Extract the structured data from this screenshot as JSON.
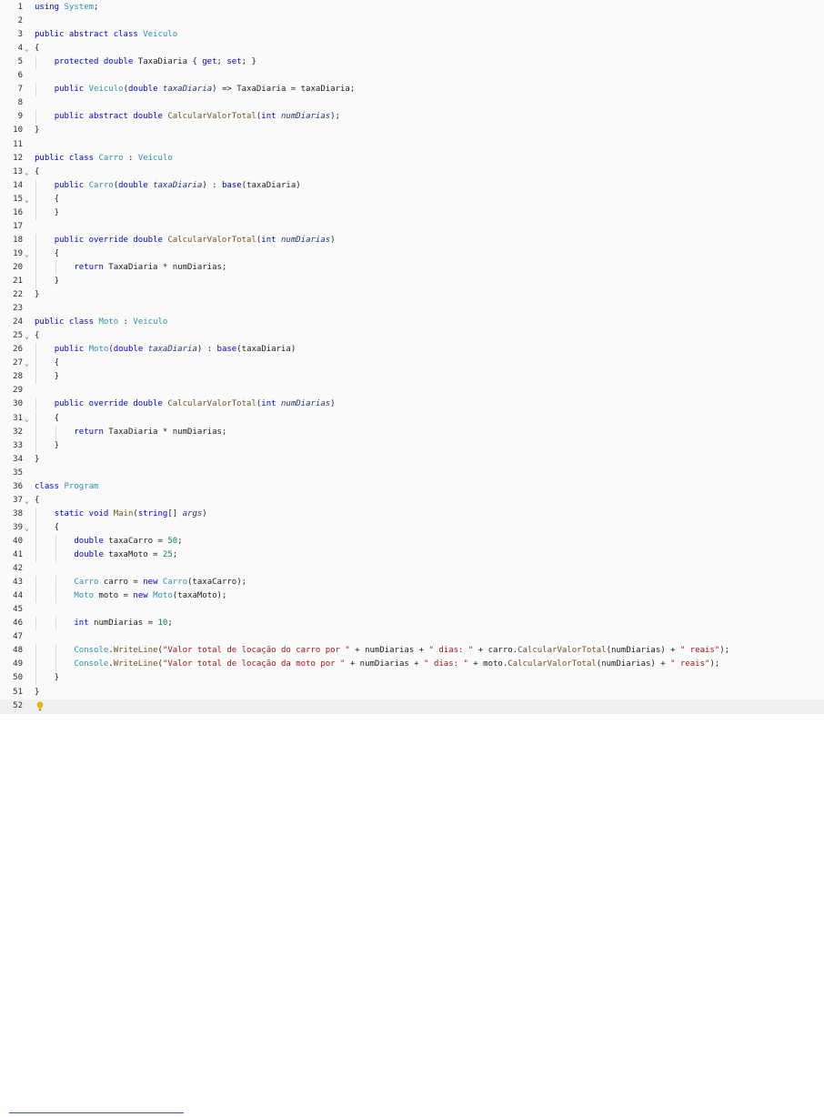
{
  "editor": {
    "language": "C#",
    "current_line": 52,
    "lines": [
      {
        "n": "1",
        "tokens": [
          [
            "kw",
            "using"
          ],
          [
            "pl",
            " "
          ],
          [
            "typ",
            "System"
          ],
          [
            "pl",
            ";"
          ]
        ]
      },
      {
        "n": "2",
        "tokens": []
      },
      {
        "n": "3",
        "tokens": [
          [
            "kw",
            "public abstract class"
          ],
          [
            "pl",
            " "
          ],
          [
            "typ",
            "Veiculo"
          ]
        ]
      },
      {
        "n": "4",
        "fold": true,
        "tokens": [
          [
            "pl",
            "{"
          ]
        ]
      },
      {
        "n": "5",
        "guides": 1,
        "tokens": [
          [
            "pl",
            "    "
          ],
          [
            "kw",
            "protected double"
          ],
          [
            "pl",
            " TaxaDiaria { "
          ],
          [
            "kw",
            "get"
          ],
          [
            "pl",
            "; "
          ],
          [
            "kw",
            "set"
          ],
          [
            "pl",
            "; }"
          ]
        ]
      },
      {
        "n": "6",
        "tokens": []
      },
      {
        "n": "7",
        "guides": 1,
        "tokens": [
          [
            "pl",
            "    "
          ],
          [
            "kw",
            "public"
          ],
          [
            "pl",
            " "
          ],
          [
            "typ",
            "Veiculo"
          ],
          [
            "pl",
            "("
          ],
          [
            "kw",
            "double"
          ],
          [
            "pl",
            " "
          ],
          [
            "prm",
            "taxaDiaria"
          ],
          [
            "pl",
            ") => TaxaDiaria = taxaDiaria;"
          ]
        ]
      },
      {
        "n": "8",
        "tokens": []
      },
      {
        "n": "9",
        "guides": 1,
        "tokens": [
          [
            "pl",
            "    "
          ],
          [
            "kw",
            "public abstract double"
          ],
          [
            "pl",
            " "
          ],
          [
            "fn",
            "CalcularValorTotal"
          ],
          [
            "pl",
            "("
          ],
          [
            "kw",
            "int"
          ],
          [
            "pl",
            " "
          ],
          [
            "prm",
            "numDiarias"
          ],
          [
            "pl",
            ");"
          ]
        ]
      },
      {
        "n": "10",
        "tokens": [
          [
            "pl",
            "}"
          ]
        ]
      },
      {
        "n": "11",
        "tokens": []
      },
      {
        "n": "12",
        "tokens": [
          [
            "kw",
            "public class"
          ],
          [
            "pl",
            " "
          ],
          [
            "typ",
            "Carro"
          ],
          [
            "pl",
            " : "
          ],
          [
            "typ",
            "Veiculo"
          ]
        ]
      },
      {
        "n": "13",
        "fold": true,
        "tokens": [
          [
            "pl",
            "{"
          ]
        ]
      },
      {
        "n": "14",
        "guides": 1,
        "tokens": [
          [
            "pl",
            "    "
          ],
          [
            "kw",
            "public"
          ],
          [
            "pl",
            " "
          ],
          [
            "typ",
            "Carro"
          ],
          [
            "pl",
            "("
          ],
          [
            "kw",
            "double"
          ],
          [
            "pl",
            " "
          ],
          [
            "prm",
            "taxaDiaria"
          ],
          [
            "pl",
            ") : "
          ],
          [
            "kw",
            "base"
          ],
          [
            "pl",
            "(taxaDiaria)"
          ]
        ]
      },
      {
        "n": "15",
        "fold": true,
        "guides": 1,
        "tokens": [
          [
            "pl",
            "    {"
          ]
        ]
      },
      {
        "n": "16",
        "guides": 1,
        "tokens": [
          [
            "pl",
            "    }"
          ]
        ]
      },
      {
        "n": "17",
        "tokens": []
      },
      {
        "n": "18",
        "guides": 1,
        "tokens": [
          [
            "pl",
            "    "
          ],
          [
            "kw",
            "public override double"
          ],
          [
            "pl",
            " "
          ],
          [
            "fn",
            "CalcularValorTotal"
          ],
          [
            "pl",
            "("
          ],
          [
            "kw",
            "int"
          ],
          [
            "pl",
            " "
          ],
          [
            "prm",
            "numDiarias"
          ],
          [
            "pl",
            ")"
          ]
        ]
      },
      {
        "n": "19",
        "fold": true,
        "guides": 1,
        "tokens": [
          [
            "pl",
            "    {"
          ]
        ]
      },
      {
        "n": "20",
        "guides": 2,
        "tokens": [
          [
            "pl",
            "        "
          ],
          [
            "kw",
            "return"
          ],
          [
            "pl",
            " TaxaDiaria * numDiarias;"
          ]
        ]
      },
      {
        "n": "21",
        "guides": 1,
        "tokens": [
          [
            "pl",
            "    }"
          ]
        ]
      },
      {
        "n": "22",
        "tokens": [
          [
            "pl",
            "}"
          ]
        ]
      },
      {
        "n": "23",
        "tokens": []
      },
      {
        "n": "24",
        "tokens": [
          [
            "kw",
            "public class"
          ],
          [
            "pl",
            " "
          ],
          [
            "typ",
            "Moto"
          ],
          [
            "pl",
            " : "
          ],
          [
            "typ",
            "Veiculo"
          ]
        ]
      },
      {
        "n": "25",
        "fold": true,
        "tokens": [
          [
            "pl",
            "{"
          ]
        ]
      },
      {
        "n": "26",
        "guides": 1,
        "tokens": [
          [
            "pl",
            "    "
          ],
          [
            "kw",
            "public"
          ],
          [
            "pl",
            " "
          ],
          [
            "typ",
            "Moto"
          ],
          [
            "pl",
            "("
          ],
          [
            "kw",
            "double"
          ],
          [
            "pl",
            " "
          ],
          [
            "prm",
            "taxaDiaria"
          ],
          [
            "pl",
            ") : "
          ],
          [
            "kw",
            "base"
          ],
          [
            "pl",
            "(taxaDiaria)"
          ]
        ]
      },
      {
        "n": "27",
        "fold": true,
        "guides": 1,
        "tokens": [
          [
            "pl",
            "    {"
          ]
        ]
      },
      {
        "n": "28",
        "guides": 1,
        "tokens": [
          [
            "pl",
            "    }"
          ]
        ]
      },
      {
        "n": "29",
        "tokens": []
      },
      {
        "n": "30",
        "guides": 1,
        "tokens": [
          [
            "pl",
            "    "
          ],
          [
            "kw",
            "public override double"
          ],
          [
            "pl",
            " "
          ],
          [
            "fn",
            "CalcularValorTotal"
          ],
          [
            "pl",
            "("
          ],
          [
            "kw",
            "int"
          ],
          [
            "pl",
            " "
          ],
          [
            "prm",
            "numDiarias"
          ],
          [
            "pl",
            ")"
          ]
        ]
      },
      {
        "n": "31",
        "fold": true,
        "guides": 1,
        "tokens": [
          [
            "pl",
            "    {"
          ]
        ]
      },
      {
        "n": "32",
        "guides": 2,
        "tokens": [
          [
            "pl",
            "        "
          ],
          [
            "kw",
            "return"
          ],
          [
            "pl",
            " TaxaDiaria * numDiarias;"
          ]
        ]
      },
      {
        "n": "33",
        "guides": 1,
        "tokens": [
          [
            "pl",
            "    }"
          ]
        ]
      },
      {
        "n": "34",
        "tokens": [
          [
            "pl",
            "}"
          ]
        ]
      },
      {
        "n": "35",
        "tokens": []
      },
      {
        "n": "36",
        "tokens": [
          [
            "kw",
            "class"
          ],
          [
            "pl",
            " "
          ],
          [
            "typ",
            "Program"
          ]
        ]
      },
      {
        "n": "37",
        "fold": true,
        "tokens": [
          [
            "pl",
            "{"
          ]
        ]
      },
      {
        "n": "38",
        "guides": 1,
        "tokens": [
          [
            "pl",
            "    "
          ],
          [
            "kw",
            "static void"
          ],
          [
            "pl",
            " "
          ],
          [
            "fn",
            "Main"
          ],
          [
            "pl",
            "("
          ],
          [
            "kw",
            "string"
          ],
          [
            "pl",
            "[] "
          ],
          [
            "prm",
            "args"
          ],
          [
            "pl",
            ")"
          ]
        ]
      },
      {
        "n": "39",
        "fold": true,
        "guides": 1,
        "tokens": [
          [
            "pl",
            "    {"
          ]
        ]
      },
      {
        "n": "40",
        "guides": 2,
        "tokens": [
          [
            "pl",
            "        "
          ],
          [
            "kw",
            "double"
          ],
          [
            "pl",
            " taxaCarro = "
          ],
          [
            "num",
            "50"
          ],
          [
            "pl",
            ";"
          ]
        ]
      },
      {
        "n": "41",
        "guides": 2,
        "tokens": [
          [
            "pl",
            "        "
          ],
          [
            "kw",
            "double"
          ],
          [
            "pl",
            " taxaMoto = "
          ],
          [
            "num",
            "25"
          ],
          [
            "pl",
            ";"
          ]
        ]
      },
      {
        "n": "42",
        "tokens": []
      },
      {
        "n": "43",
        "guides": 2,
        "tokens": [
          [
            "pl",
            "        "
          ],
          [
            "typ",
            "Carro"
          ],
          [
            "pl",
            " carro = "
          ],
          [
            "kw",
            "new"
          ],
          [
            "pl",
            " "
          ],
          [
            "typ",
            "Carro"
          ],
          [
            "pl",
            "(taxaCarro);"
          ]
        ]
      },
      {
        "n": "44",
        "guides": 2,
        "tokens": [
          [
            "pl",
            "        "
          ],
          [
            "typ",
            "Moto"
          ],
          [
            "pl",
            " moto = "
          ],
          [
            "kw",
            "new"
          ],
          [
            "pl",
            " "
          ],
          [
            "typ",
            "Moto"
          ],
          [
            "pl",
            "(taxaMoto);"
          ]
        ]
      },
      {
        "n": "45",
        "tokens": []
      },
      {
        "n": "46",
        "guides": 2,
        "tokens": [
          [
            "pl",
            "        "
          ],
          [
            "kw",
            "int"
          ],
          [
            "pl",
            " numDiarias = "
          ],
          [
            "num",
            "10"
          ],
          [
            "pl",
            ";"
          ]
        ]
      },
      {
        "n": "47",
        "tokens": []
      },
      {
        "n": "48",
        "guides": 2,
        "tokens": [
          [
            "pl",
            "        "
          ],
          [
            "typ",
            "Console"
          ],
          [
            "pl",
            "."
          ],
          [
            "fn",
            "WriteLine"
          ],
          [
            "pl",
            "("
          ],
          [
            "str",
            "\"Valor total de locação do carro por \""
          ],
          [
            "pl",
            " + numDiarias + "
          ],
          [
            "str",
            "\" dias: \""
          ],
          [
            "pl",
            " + carro."
          ],
          [
            "fn",
            "CalcularValorTotal"
          ],
          [
            "pl",
            "(numDiarias) + "
          ],
          [
            "str",
            "\" reais\""
          ],
          [
            "pl",
            ");"
          ]
        ]
      },
      {
        "n": "49",
        "guides": 2,
        "tokens": [
          [
            "pl",
            "        "
          ],
          [
            "typ",
            "Console"
          ],
          [
            "pl",
            "."
          ],
          [
            "fn",
            "WriteLine"
          ],
          [
            "pl",
            "("
          ],
          [
            "str",
            "\"Valor total de locação da moto por \""
          ],
          [
            "pl",
            " + numDiarias + "
          ],
          [
            "str",
            "\" dias: \""
          ],
          [
            "pl",
            " + moto."
          ],
          [
            "fn",
            "CalcularValorTotal"
          ],
          [
            "pl",
            "(numDiarias) + "
          ],
          [
            "str",
            "\" reais\""
          ],
          [
            "pl",
            ");"
          ]
        ]
      },
      {
        "n": "50",
        "guides": 1,
        "tokens": [
          [
            "pl",
            "    }"
          ]
        ]
      },
      {
        "n": "51",
        "tokens": [
          [
            "pl",
            "}"
          ]
        ]
      },
      {
        "n": "52",
        "bulb": true,
        "tokens": []
      }
    ]
  },
  "colors": {
    "keyword": "#0000ee",
    "type": "#2b91af",
    "method": "#74531f",
    "string": "#a31515",
    "number": "#098658",
    "parameter": "#1f377f",
    "editor_background": "#fafafa",
    "lightbulb": "#e6b800"
  },
  "icons": {
    "fold": "chevron-down-icon",
    "quick_action": "lightbulb-icon"
  },
  "footnote_rule": true
}
